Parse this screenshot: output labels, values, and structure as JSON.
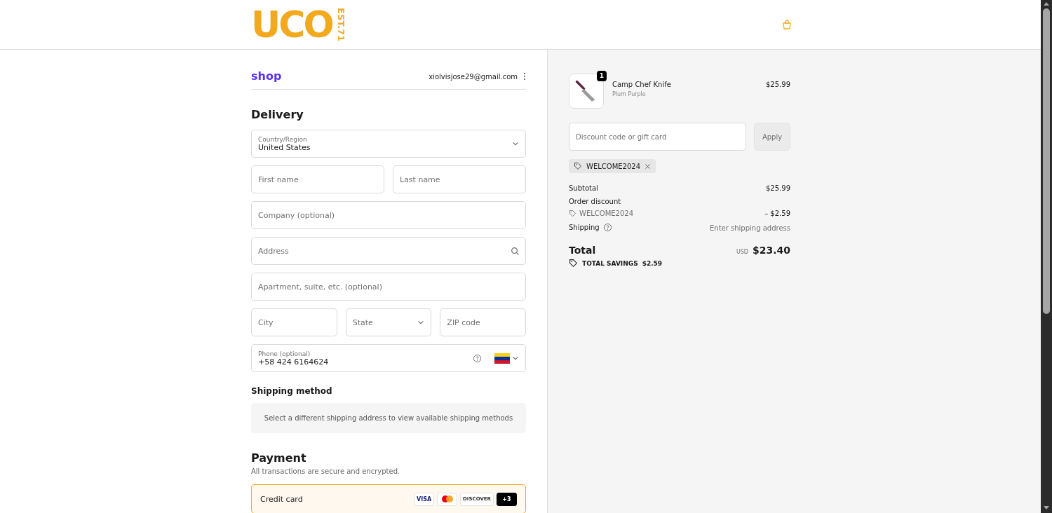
{
  "header": {
    "logo": {
      "text": "UCO",
      "tagline": "EST.71"
    }
  },
  "account": {
    "brand": "shop",
    "email": "xiolvisjose29@gmail.com"
  },
  "delivery": {
    "title": "Delivery",
    "rows": [
      [
        {
          "kind": "select",
          "label": "Country/Region",
          "value": "United States"
        }
      ],
      [
        {
          "kind": "text",
          "placeholder": "First name"
        },
        {
          "kind": "text",
          "placeholder": "Last name"
        }
      ],
      [
        {
          "kind": "text",
          "placeholder": "Company (optional)"
        }
      ],
      [
        {
          "kind": "search",
          "placeholder": "Address"
        }
      ],
      [
        {
          "kind": "text",
          "placeholder": "Apartment, suite, etc. (optional)"
        }
      ],
      [
        {
          "kind": "text",
          "placeholder": "City"
        },
        {
          "kind": "select",
          "placeholder": "State"
        },
        {
          "kind": "text",
          "placeholder": "ZIP code"
        }
      ],
      [
        {
          "kind": "phone",
          "label": "Phone (optional)",
          "value": "+58 424 6164624"
        }
      ]
    ]
  },
  "shipping_method": {
    "title": "Shipping method",
    "notice": "Select a different shipping address to view available shipping methods"
  },
  "payment": {
    "title": "Payment",
    "subtitle": "All transactions are secure and encrypted.",
    "options": [
      {
        "label": "Credit card",
        "selected": true,
        "cards": [
          {
            "kind": "visa",
            "label": "VISA"
          },
          {
            "kind": "mastercard"
          },
          {
            "kind": "discover",
            "label": "DISCOVER"
          },
          {
            "kind": "more",
            "label": "+3"
          }
        ]
      }
    ]
  },
  "summary": {
    "items": [
      {
        "name": "Camp Chef Knife",
        "variant": "Plum Purple",
        "price": "$25.99",
        "quantity": "1"
      }
    ],
    "discount": {
      "placeholder": "Discount code or gift card",
      "button": "Apply",
      "applied": [
        {
          "code": "WELCOME2024"
        }
      ]
    },
    "lines": [
      {
        "kind": "plain",
        "label": "Subtotal",
        "value": "$25.99"
      },
      {
        "kind": "discount",
        "label": "Order discount",
        "code": "WELCOME2024",
        "value": "– $2.59"
      },
      {
        "kind": "help",
        "label": "Shipping",
        "value": "Enter shipping address"
      }
    ],
    "total": {
      "label": "Total",
      "currency": "USD",
      "value": "$23.40"
    },
    "savings": {
      "label": "TOTAL SAVINGS",
      "value": "$2.59"
    }
  }
}
